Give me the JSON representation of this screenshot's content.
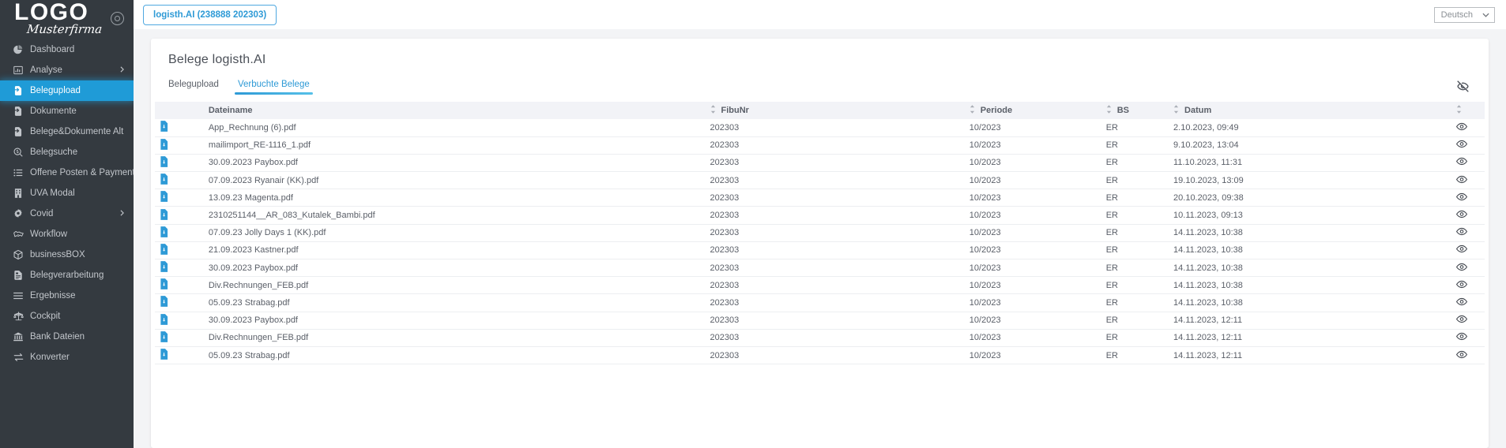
{
  "sidebar": {
    "logo_main": "LOGO",
    "logo_sub": "Musterfirma",
    "items": [
      {
        "label": "Dashboard",
        "icon": "pie-chart-icon",
        "active": false,
        "caret": false
      },
      {
        "label": "Analyse",
        "icon": "bar-chart-icon",
        "active": false,
        "caret": true
      },
      {
        "label": "Belegupload",
        "icon": "document-upload-icon",
        "active": true,
        "caret": false
      },
      {
        "label": "Dokumente",
        "icon": "document-upload-icon",
        "active": false,
        "caret": false
      },
      {
        "label": "Belege&Dokumente Alt",
        "icon": "document-upload-icon",
        "active": false,
        "caret": false
      },
      {
        "label": "Belegsuche",
        "icon": "search-dollar-icon",
        "active": false,
        "caret": false
      },
      {
        "label": "Offene Posten & Payment",
        "icon": "list-icon",
        "active": false,
        "caret": false
      },
      {
        "label": "UVA Modal",
        "icon": "building-icon",
        "active": false,
        "caret": false
      },
      {
        "label": "Covid",
        "icon": "virus-icon",
        "active": false,
        "caret": true
      },
      {
        "label": "Workflow",
        "icon": "handshake-icon",
        "active": false,
        "caret": false
      },
      {
        "label": "businessBOX",
        "icon": "box-icon",
        "active": false,
        "caret": false
      },
      {
        "label": "Belegverarbeitung",
        "icon": "file-invoice-icon",
        "active": false,
        "caret": false
      },
      {
        "label": "Ergebnisse",
        "icon": "bars-icon",
        "active": false,
        "caret": false
      },
      {
        "label": "Cockpit",
        "icon": "balance-scale-icon",
        "active": false,
        "caret": false
      },
      {
        "label": "Bank Dateien",
        "icon": "bank-icon",
        "active": false,
        "caret": false
      },
      {
        "label": "Konverter",
        "icon": "exchange-arrows-icon",
        "active": false,
        "caret": false
      }
    ]
  },
  "topbar": {
    "tab_pill": "logisth.AI (238888 202303)",
    "language": "Deutsch",
    "chevron": "⌄"
  },
  "page": {
    "title": "Belege logisth.AI",
    "tabs": [
      {
        "label": "Belegupload",
        "active": false
      },
      {
        "label": "Verbuchte Belege",
        "active": true
      }
    ],
    "toggle_visibility_icon": "eye-off-icon"
  },
  "table": {
    "columns": [
      {
        "key": "icon",
        "label": "",
        "sortable": false
      },
      {
        "key": "name",
        "label": "Dateiname",
        "sortable": false
      },
      {
        "key": "fibu",
        "label": "FibuNr",
        "sortable": true
      },
      {
        "key": "periode",
        "label": "Periode",
        "sortable": true
      },
      {
        "key": "bs",
        "label": "BS",
        "sortable": true
      },
      {
        "key": "datum",
        "label": "Datum",
        "sortable": true
      },
      {
        "key": "actions",
        "label": "",
        "sortable": true
      }
    ],
    "rows": [
      {
        "icon": "pdf-file-icon",
        "name": "App_Rechnung (6).pdf",
        "fibu": "202303",
        "periode": "10/2023",
        "bs": "ER",
        "datum": "2.10.2023, 09:49",
        "action": "eye-icon"
      },
      {
        "icon": "pdf-file-icon",
        "name": "mailimport_RE-1116_1.pdf",
        "fibu": "202303",
        "periode": "10/2023",
        "bs": "ER",
        "datum": "9.10.2023, 13:04",
        "action": "eye-icon"
      },
      {
        "icon": "pdf-file-icon",
        "name": "30.09.2023 Paybox.pdf",
        "fibu": "202303",
        "periode": "10/2023",
        "bs": "ER",
        "datum": "11.10.2023, 11:31",
        "action": "eye-icon"
      },
      {
        "icon": "pdf-file-icon",
        "name": "07.09.2023 Ryanair (KK).pdf",
        "fibu": "202303",
        "periode": "10/2023",
        "bs": "ER",
        "datum": "19.10.2023, 13:09",
        "action": "eye-icon"
      },
      {
        "icon": "pdf-file-icon",
        "name": "13.09.23 Magenta.pdf",
        "fibu": "202303",
        "periode": "10/2023",
        "bs": "ER",
        "datum": "20.10.2023, 09:38",
        "action": "eye-icon"
      },
      {
        "icon": "pdf-file-icon",
        "name": "2310251144__AR_083_Kutalek_Bambi.pdf",
        "fibu": "202303",
        "periode": "10/2023",
        "bs": "ER",
        "datum": "10.11.2023, 09:13",
        "action": "eye-icon"
      },
      {
        "icon": "pdf-file-icon",
        "name": "07.09.23 Jolly Days 1 (KK).pdf",
        "fibu": "202303",
        "periode": "10/2023",
        "bs": "ER",
        "datum": "14.11.2023, 10:38",
        "action": "eye-icon"
      },
      {
        "icon": "pdf-file-icon",
        "name": "21.09.2023 Kastner.pdf",
        "fibu": "202303",
        "periode": "10/2023",
        "bs": "ER",
        "datum": "14.11.2023, 10:38",
        "action": "eye-icon"
      },
      {
        "icon": "pdf-file-icon",
        "name": "30.09.2023 Paybox.pdf",
        "fibu": "202303",
        "periode": "10/2023",
        "bs": "ER",
        "datum": "14.11.2023, 10:38",
        "action": "eye-icon"
      },
      {
        "icon": "pdf-file-icon",
        "name": "Div.Rechnungen_FEB.pdf",
        "fibu": "202303",
        "periode": "10/2023",
        "bs": "ER",
        "datum": "14.11.2023, 10:38",
        "action": "eye-icon"
      },
      {
        "icon": "pdf-file-icon",
        "name": "05.09.23 Strabag.pdf",
        "fibu": "202303",
        "periode": "10/2023",
        "bs": "ER",
        "datum": "14.11.2023, 10:38",
        "action": "eye-icon"
      },
      {
        "icon": "pdf-file-icon",
        "name": "30.09.2023 Paybox.pdf",
        "fibu": "202303",
        "periode": "10/2023",
        "bs": "ER",
        "datum": "14.11.2023, 12:11",
        "action": "eye-icon"
      },
      {
        "icon": "pdf-file-icon",
        "name": "Div.Rechnungen_FEB.pdf",
        "fibu": "202303",
        "periode": "10/2023",
        "bs": "ER",
        "datum": "14.11.2023, 12:11",
        "action": "eye-icon"
      },
      {
        "icon": "pdf-file-icon",
        "name": "05.09.23 Strabag.pdf",
        "fibu": "202303",
        "periode": "10/2023",
        "bs": "ER",
        "datum": "14.11.2023, 12:11",
        "action": "eye-icon"
      }
    ]
  },
  "colors": {
    "accent": "#2e9ad6",
    "sidebar_bg": "#343a40",
    "page_bg": "#f3f4f6",
    "header_row_bg": "#f2f3f7"
  }
}
